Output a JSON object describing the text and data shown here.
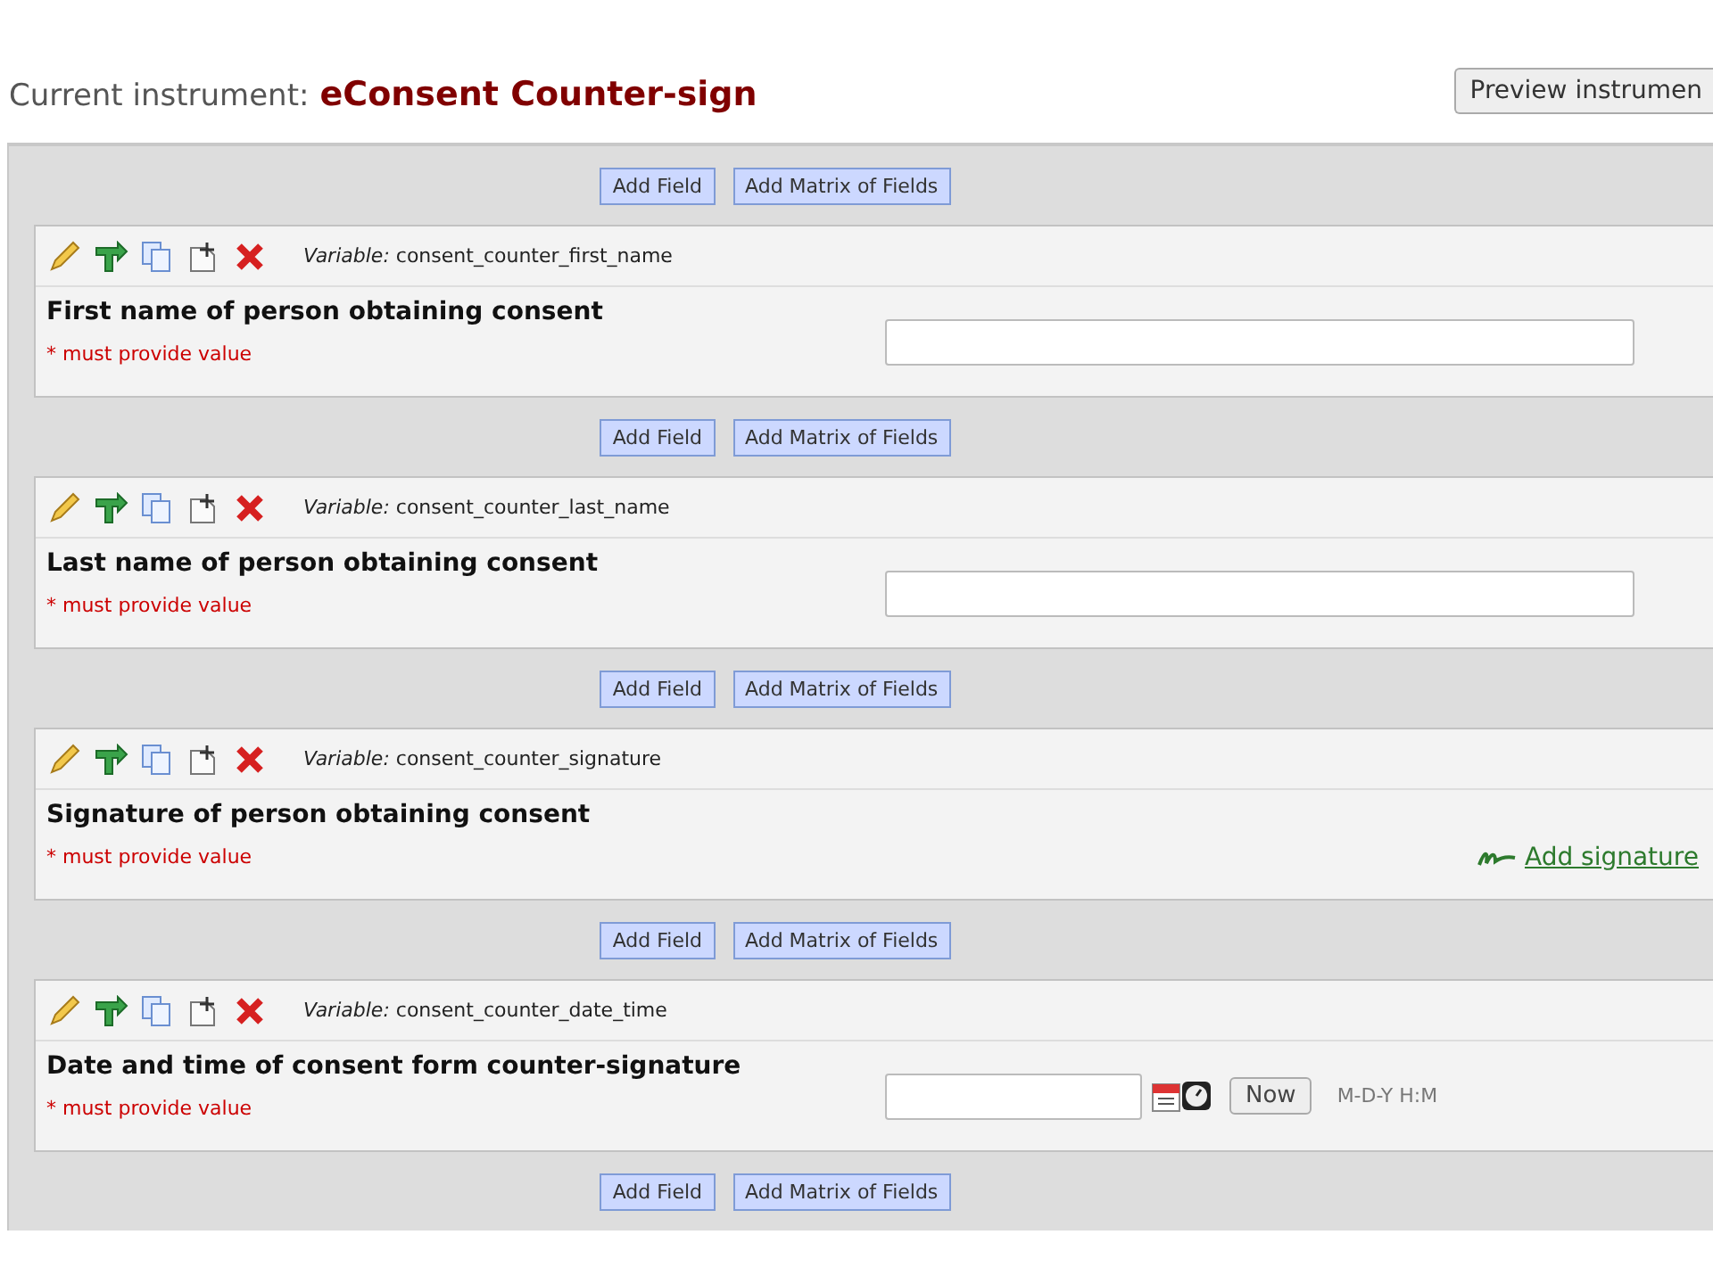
{
  "header": {
    "label": "Current instrument:",
    "instrument": "eConsent Counter-sign",
    "preview_button": "Preview instrumen"
  },
  "add_bars": [
    {
      "add_field": "Add Field",
      "add_matrix": "Add Matrix of Fields"
    },
    {
      "add_field": "Add Field",
      "add_matrix": "Add Matrix of Fields"
    },
    {
      "add_field": "Add Field",
      "add_matrix": "Add Matrix of Fields"
    },
    {
      "add_field": "Add Field",
      "add_matrix": "Add Matrix of Fields"
    },
    {
      "add_field": "Add Field",
      "add_matrix": "Add Matrix of Fields"
    }
  ],
  "fields": [
    {
      "kind": "text",
      "variable_label": "Variable:",
      "variable": "consent_counter_first_name",
      "label": "First name of person obtaining consent",
      "required_note": "* must provide value"
    },
    {
      "kind": "text",
      "variable_label": "Variable:",
      "variable": "consent_counter_last_name",
      "label": "Last name of person obtaining consent",
      "required_note": "* must provide value"
    },
    {
      "kind": "signature",
      "variable_label": "Variable:",
      "variable": "consent_counter_signature",
      "label": "Signature of person obtaining consent",
      "required_note": "* must provide value",
      "link": "Add signature"
    },
    {
      "kind": "datetime",
      "variable_label": "Variable:",
      "variable": "consent_counter_date_time",
      "label": "Date and time of consent form counter-signature",
      "required_note": "* must provide value",
      "now_button": "Now",
      "format": "M-D-Y H:M"
    }
  ]
}
